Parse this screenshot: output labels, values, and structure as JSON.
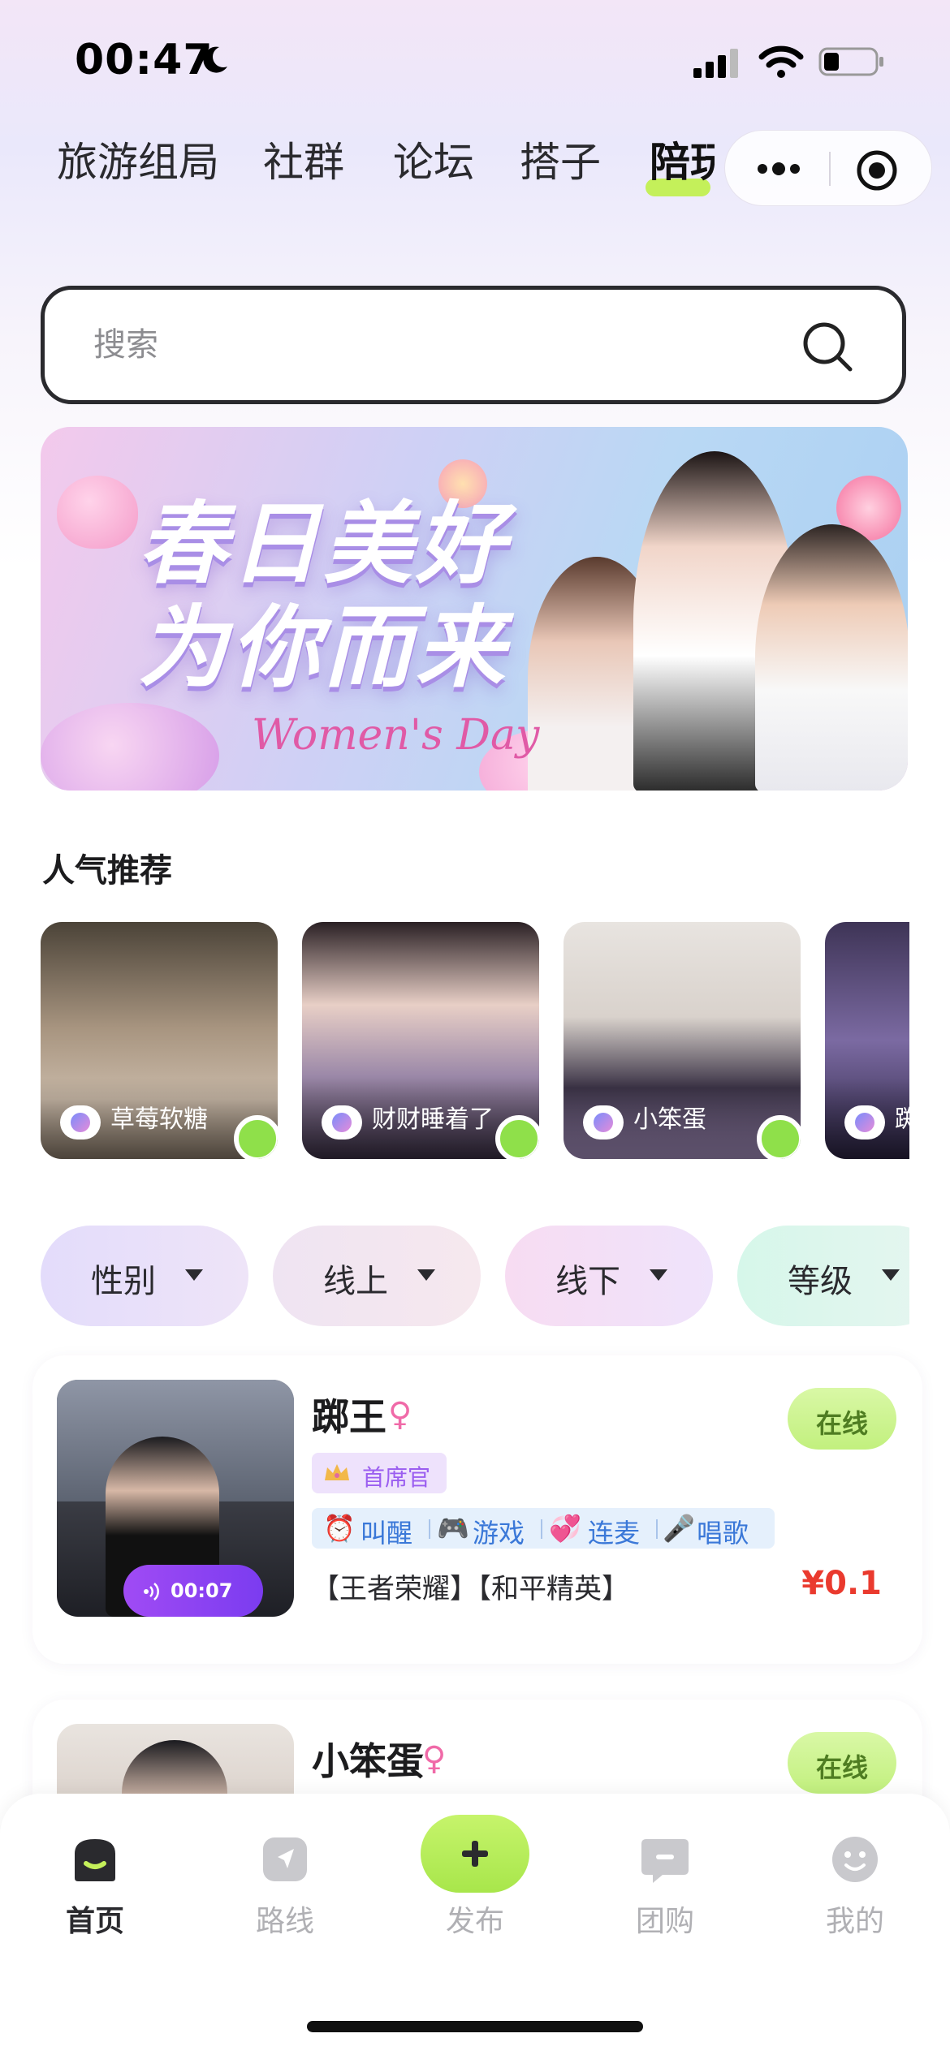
{
  "status_bar": {
    "time": "00:47"
  },
  "tabs": [
    {
      "label": "旅游组局"
    },
    {
      "label": "社群"
    },
    {
      "label": "论坛"
    },
    {
      "label": "搭子"
    },
    {
      "label": "陪玩"
    }
  ],
  "search": {
    "placeholder": "搜索"
  },
  "banner": {
    "title_line1": "春日美好",
    "title_line2": "为你而来",
    "subtitle": "Women's Day"
  },
  "section": {
    "title": "人气推荐"
  },
  "recommend": [
    {
      "name": "草莓软糖"
    },
    {
      "name": "财财睡着了"
    },
    {
      "name": "小笨蛋"
    },
    {
      "name": "踯"
    }
  ],
  "filters": [
    {
      "label": "性别"
    },
    {
      "label": "线上"
    },
    {
      "label": "线下"
    },
    {
      "label": "等级"
    }
  ],
  "listings": [
    {
      "name": "踯王",
      "gender": "♀",
      "status": "在线",
      "rank": "首席官",
      "voice_duration": "00:07",
      "tags": [
        "叫醒",
        "游戏",
        "连麦",
        "唱歌"
      ],
      "games": "【王者荣耀】【和平精英】",
      "price": "¥0.1"
    },
    {
      "name": "小笨蛋",
      "gender": "♀",
      "status": "在线"
    }
  ],
  "nav": [
    {
      "label": "首页"
    },
    {
      "label": "路线"
    },
    {
      "label": "发布"
    },
    {
      "label": "团购"
    },
    {
      "label": "我的"
    }
  ],
  "colors": {
    "accent_green": "#b6ec5a",
    "price_red": "#ea3a2e",
    "tag_blue": "#3a78d8",
    "rank_purple": "#9b5ef0"
  }
}
